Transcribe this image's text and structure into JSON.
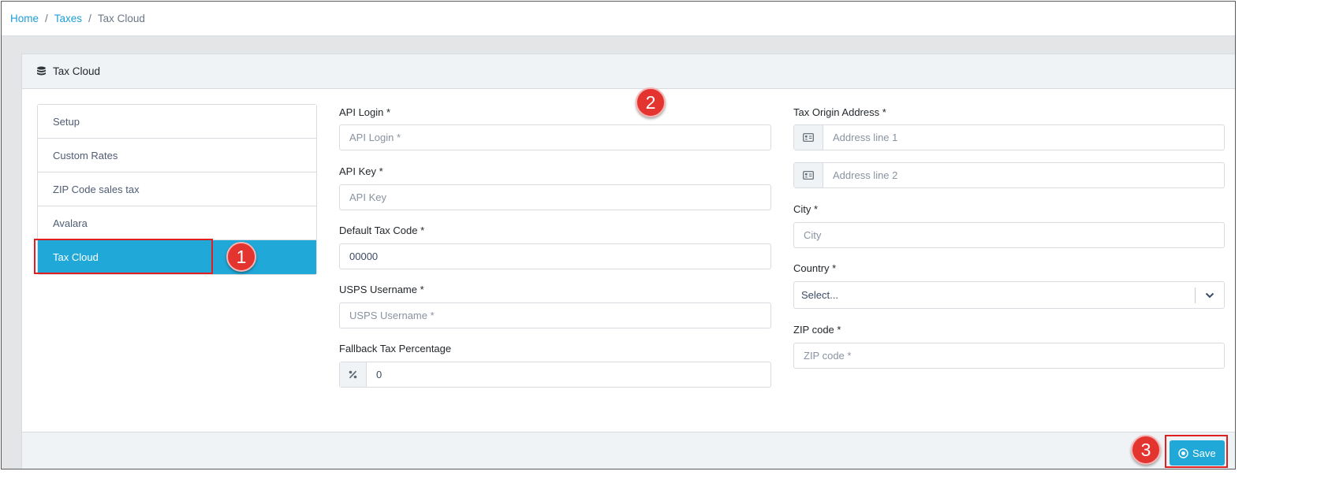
{
  "breadcrumb": {
    "items": [
      "Home",
      "Taxes"
    ],
    "current": "Tax Cloud"
  },
  "card": {
    "title": "Tax Cloud",
    "icon": "database-icon"
  },
  "sidenav": {
    "items": [
      "Setup",
      "Custom Rates",
      "ZIP Code sales tax",
      "Avalara",
      "Tax Cloud"
    ],
    "active": "Tax Cloud"
  },
  "form_left": {
    "api_login": {
      "label": "API Login *",
      "placeholder": "API Login *"
    },
    "api_key": {
      "label": "API Key *",
      "placeholder": "API Key"
    },
    "default_tax_code": {
      "label": "Default Tax Code *",
      "value": "00000"
    },
    "usps_username": {
      "label": "USPS Username *",
      "placeholder": "USPS Username *"
    },
    "fallback_tax": {
      "label": "Fallback Tax Percentage",
      "value": "0",
      "icon": "percent-icon"
    }
  },
  "form_right": {
    "origin_address": {
      "label": "Tax Origin Address *",
      "line1_placeholder": "Address line 1",
      "line2_placeholder": "Address line 2",
      "icon": "address-card-icon"
    },
    "city": {
      "label": "City *",
      "placeholder": "City"
    },
    "country": {
      "label": "Country *",
      "value": "Select..."
    },
    "zip": {
      "label": "ZIP code *",
      "placeholder": "ZIP code *"
    }
  },
  "footer": {
    "save_label": "Save",
    "save_icon": "circle-dot-icon"
  },
  "annotations": {
    "badges": [
      "1",
      "2",
      "3"
    ],
    "color": "#e3342f"
  },
  "colors": {
    "accent": "#20a8d8",
    "link": "#1e9fd6"
  }
}
